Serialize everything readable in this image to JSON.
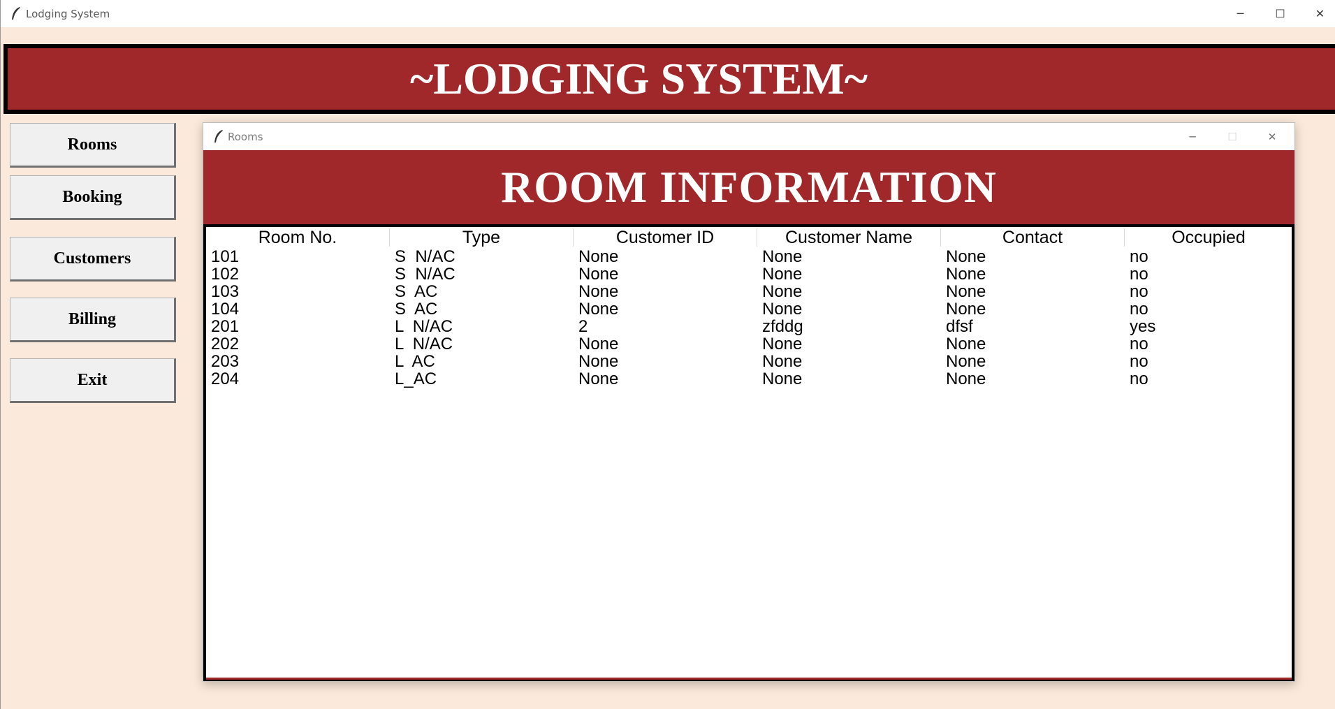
{
  "main_window": {
    "title": "Lodging System"
  },
  "window_controls": {
    "minimize": "─",
    "maximize": "☐",
    "close": "✕"
  },
  "banner": {
    "title": "~LODGING SYSTEM~"
  },
  "sidebar": {
    "rooms": "Rooms",
    "booking": "Booking",
    "customers": "Customers",
    "billing": "Billing",
    "exit": "Exit"
  },
  "rooms_window": {
    "title": "Rooms",
    "heading": "ROOM INFORMATION",
    "table": {
      "columns": [
        "Room No.",
        "Type",
        "Customer ID",
        "Customer Name",
        "Contact",
        "Occupied"
      ],
      "rows": [
        [
          "101",
          "S  N/AC",
          "None",
          "None",
          "None",
          "no"
        ],
        [
          "102",
          "S  N/AC",
          "None",
          "None",
          "None",
          "no"
        ],
        [
          "103",
          "S  AC",
          "None",
          "None",
          "None",
          "no"
        ],
        [
          "104",
          "S  AC",
          "None",
          "None",
          "None",
          "no"
        ],
        [
          "201",
          "L  N/AC",
          "2",
          "zfddg",
          "dfsf",
          "yes"
        ],
        [
          "202",
          "L  N/AC",
          "None",
          "None",
          "None",
          "no"
        ],
        [
          "203",
          "L  AC",
          "None",
          "None",
          "None",
          "no"
        ],
        [
          "204",
          "L_AC",
          "None",
          "None",
          "None",
          "no"
        ]
      ]
    }
  },
  "colors": {
    "accent": "#a0282b",
    "background": "#fbeadb"
  }
}
